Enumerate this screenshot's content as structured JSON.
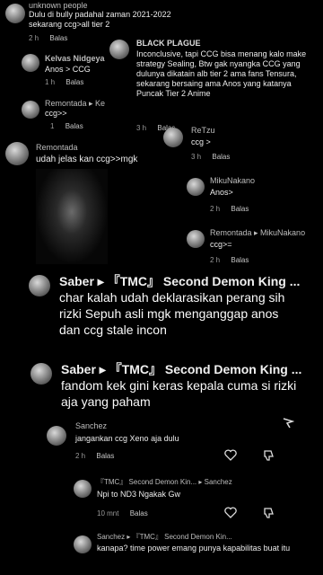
{
  "comments": [
    {
      "id": "c1",
      "name": "unknown people",
      "text": "Dulu di bully padahal zaman 2021-2022 sekarang ccg>all tier 2",
      "time": "2 h",
      "reply": "Balas"
    },
    {
      "id": "c2",
      "name": "Kelvas Nidgeya",
      "text": "Anos > CCG",
      "time": "1 h",
      "reply": "Balas"
    },
    {
      "id": "c3",
      "name": "Remontada ▸ Ke",
      "text": "ccg>>",
      "time": "1",
      "reply": "Balas"
    },
    {
      "id": "c4",
      "name": "BLACK PLAGUE",
      "text": "Inconclusive, tapi CCG bisa menang kalo make strategy Sealing, Btw gak nyangka CCG yang dulunya dikatain alb tier 2 ama fans Tensura, sekarang bersaing ama Anos yang katanya Puncak Tier 2 Anime",
      "time": "3 h",
      "reply": "Balas"
    },
    {
      "id": "c5",
      "name": "ReTzu",
      "text": "ccg >",
      "time": "3 h",
      "reply": "Balas"
    },
    {
      "id": "c6",
      "name": "Remontada",
      "text": "udah jelas kan ccg>>mgk",
      "time": "",
      "reply": ""
    },
    {
      "id": "c7",
      "name": "MikuNakano",
      "text": "Anos>",
      "time": "2 h",
      "reply": "Balas"
    },
    {
      "id": "c8",
      "name": "Remontada ▸ MikuNakano",
      "text": "ccg>=",
      "time": "2 h",
      "reply": "Balas"
    },
    {
      "id": "c9",
      "name": "Saber ▸ 『TMC』 Second Demon King ...",
      "text": "char kalah udah deklarasikan perang sih rizki Sepuh asli mgk menganggap anos dan ccg stale incon",
      "time": "",
      "reply": ""
    },
    {
      "id": "c10",
      "name": "Saber ▸ 『TMC』 Second Demon King ...",
      "text": "fandom kek gini keras kepala cuma si rizki aja yang paham",
      "time": "",
      "reply": ""
    },
    {
      "id": "c11",
      "name": "Sanchez",
      "text": "jangankan ccg Xeno aja dulu",
      "time": "2 h",
      "reply": "Balas"
    },
    {
      "id": "c12",
      "name": "『TMC』 Second Demon Kin... ▸ Sanchez",
      "text": "Npi to ND3 Ngakak Gw",
      "time": "10 mnt",
      "reply": "Balas"
    },
    {
      "id": "c13",
      "name": "Sanchez ▸ 『TMC』 Second Demon Kin...",
      "text": "kanapa? time power emang punya kapabilitas buat itu",
      "time": "",
      "reply": ""
    }
  ],
  "icons": {
    "like": "heart-icon",
    "dislike": "thumbs-down-icon",
    "share": "reply-arrow-icon"
  }
}
